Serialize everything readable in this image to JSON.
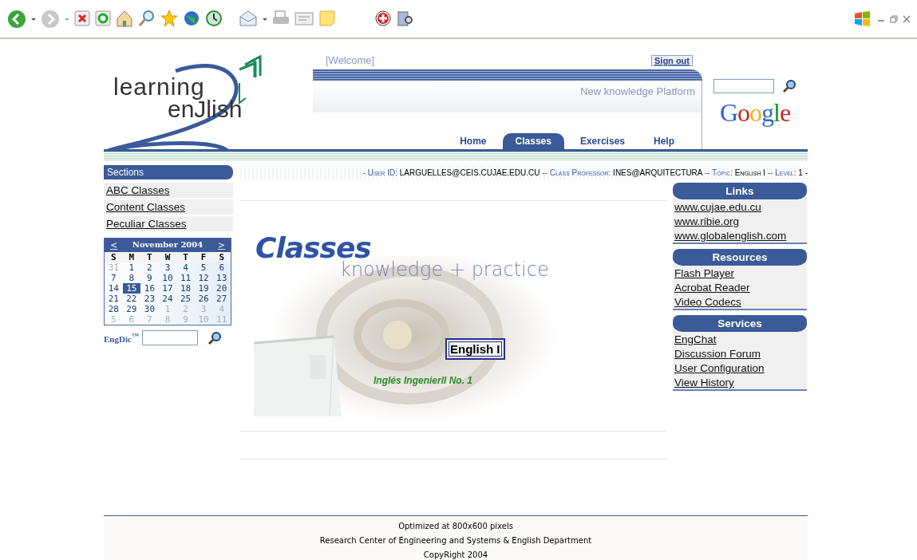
{
  "header": {
    "welcome": "[Welcome]",
    "sign_out": "Sign out",
    "logo_top": "learning",
    "logo_bottom": "enJlish",
    "tagline": "New knowledge Platform",
    "google": "Google",
    "nav": [
      {
        "label": "Home",
        "selected": false
      },
      {
        "label": "Classes",
        "selected": true
      },
      {
        "label": "Exercises",
        "selected": false
      },
      {
        "label": "Help",
        "selected": false
      }
    ]
  },
  "info_bar": {
    "sections_title": "Sections",
    "parts": [
      {
        "label": "- User ID:",
        "value": "LARGUELLES@CEIS.CUJAE.EDU.CU"
      },
      {
        "label": "-- Class Professor:",
        "value": "INES@ARQUITECTURA"
      },
      {
        "label": "-- Topic:",
        "value": "English I"
      },
      {
        "label": "-- Level:",
        "value": "1 -"
      }
    ]
  },
  "sidebar": {
    "items": [
      "ABC Classes",
      "Content Classes",
      "Peculiar Classes"
    ],
    "calendar": {
      "prev": "<",
      "title": "November 2004",
      "next": ">",
      "weekdays": [
        "S",
        "M",
        "T",
        "W",
        "T",
        "F",
        "S"
      ],
      "weeks": [
        [
          {
            "day": "31",
            "muted": true,
            "selected": false
          },
          {
            "day": "1",
            "muted": false,
            "selected": false
          },
          {
            "day": "2",
            "muted": false,
            "selected": false
          },
          {
            "day": "3",
            "muted": false,
            "selected": false
          },
          {
            "day": "4",
            "muted": false,
            "selected": false
          },
          {
            "day": "5",
            "muted": false,
            "selected": false
          },
          {
            "day": "6",
            "muted": false,
            "selected": false
          }
        ],
        [
          {
            "day": "7",
            "muted": false,
            "selected": false
          },
          {
            "day": "8",
            "muted": false,
            "selected": false
          },
          {
            "day": "9",
            "muted": false,
            "selected": false
          },
          {
            "day": "10",
            "muted": false,
            "selected": false
          },
          {
            "day": "11",
            "muted": false,
            "selected": false
          },
          {
            "day": "12",
            "muted": false,
            "selected": false
          },
          {
            "day": "13",
            "muted": false,
            "selected": false
          }
        ],
        [
          {
            "day": "14",
            "muted": false,
            "selected": false
          },
          {
            "day": "15",
            "muted": false,
            "selected": true
          },
          {
            "day": "16",
            "muted": false,
            "selected": false
          },
          {
            "day": "17",
            "muted": false,
            "selected": false
          },
          {
            "day": "18",
            "muted": false,
            "selected": false
          },
          {
            "day": "19",
            "muted": false,
            "selected": false
          },
          {
            "day": "20",
            "muted": false,
            "selected": false
          }
        ],
        [
          {
            "day": "21",
            "muted": false,
            "selected": false
          },
          {
            "day": "22",
            "muted": false,
            "selected": false
          },
          {
            "day": "23",
            "muted": false,
            "selected": false
          },
          {
            "day": "24",
            "muted": false,
            "selected": false
          },
          {
            "day": "25",
            "muted": false,
            "selected": false
          },
          {
            "day": "26",
            "muted": false,
            "selected": false
          },
          {
            "day": "27",
            "muted": false,
            "selected": false
          }
        ],
        [
          {
            "day": "28",
            "muted": false,
            "selected": false
          },
          {
            "day": "29",
            "muted": false,
            "selected": false
          },
          {
            "day": "30",
            "muted": false,
            "selected": false
          },
          {
            "day": "1",
            "muted": true,
            "selected": false
          },
          {
            "day": "2",
            "muted": true,
            "selected": false
          },
          {
            "day": "3",
            "muted": true,
            "selected": false
          },
          {
            "day": "4",
            "muted": true,
            "selected": false
          }
        ],
        [
          {
            "day": "5",
            "muted": true,
            "selected": false
          },
          {
            "day": "6",
            "muted": true,
            "selected": false
          },
          {
            "day": "7",
            "muted": true,
            "selected": false
          },
          {
            "day": "8",
            "muted": true,
            "selected": false
          },
          {
            "day": "9",
            "muted": true,
            "selected": false
          },
          {
            "day": "10",
            "muted": true,
            "selected": false
          },
          {
            "day": "11",
            "muted": true,
            "selected": false
          }
        ]
      ]
    },
    "dictionary_label": "EngDic$^{™}$"
  },
  "main": {
    "title": "Classes",
    "subtitle": "knowledge + practice",
    "course_button": "English I",
    "course_name": "Inglés Ingenierll No. 1"
  },
  "right_sidebar": [
    {
      "title": "Links",
      "items": [
        "www.cujae.edu.cu",
        "www.ribie.org",
        "www.globalenglish.com"
      ]
    },
    {
      "title": "Resources",
      "items": [
        "Flash Player",
        "Acrobat Reader",
        "Video Codecs"
      ]
    },
    {
      "title": "Services",
      "items": [
        "EngChat",
        "Discussion Forum",
        "User Configuration",
        "View History"
      ]
    }
  ],
  "footer": [
    "Optimized at 800x600 pixels",
    "Research Center of Engineering and Systems & English Department",
    "CopyRight 2004"
  ]
}
